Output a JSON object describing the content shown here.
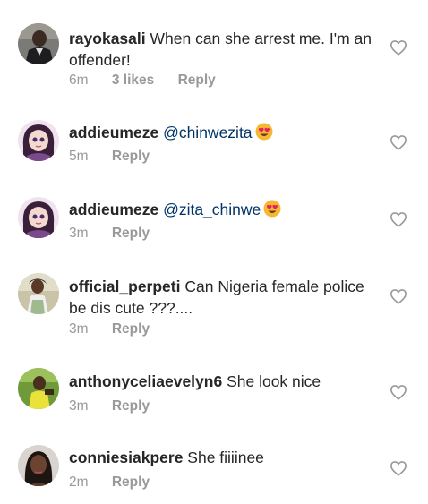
{
  "comments": [
    {
      "username": "rayokasali",
      "text": "When can she arrest me. I'm an offender!",
      "mention": "",
      "has_emoji": false,
      "time": "6m",
      "likes": "3 likes",
      "reply": "Reply",
      "avatar": "dark-suit-avatar"
    },
    {
      "username": "addieumeze",
      "text": "",
      "mention": "@chinwezita",
      "has_emoji": true,
      "time": "5m",
      "likes": "",
      "reply": "Reply",
      "avatar": "cartoon-girl-avatar"
    },
    {
      "username": "addieumeze",
      "text": "",
      "mention": "@zita_chinwe",
      "has_emoji": true,
      "time": "3m",
      "likes": "",
      "reply": "Reply",
      "avatar": "cartoon-girl-avatar"
    },
    {
      "username": "official_perpeti",
      "text": "Can Nigeria female police be dis cute ???....",
      "mention": "",
      "has_emoji": false,
      "time": "3m",
      "likes": "",
      "reply": "Reply",
      "avatar": "photo-woman-avatar"
    },
    {
      "username": "anthonyceliaevelyn6",
      "text": "She look nice",
      "mention": "",
      "has_emoji": false,
      "time": "3m",
      "likes": "",
      "reply": "Reply",
      "avatar": "green-photo-avatar"
    },
    {
      "username": "conniesiakpere",
      "text": "She fiiiinee",
      "mention": "",
      "has_emoji": false,
      "time": "2m",
      "likes": "",
      "reply": "Reply",
      "avatar": "portrait-woman-avatar"
    }
  ],
  "colors": {
    "text": "#262626",
    "mention": "#003569",
    "meta": "#999999",
    "heart_outline": "#999999",
    "emoji_face": "#f7b733",
    "emoji_heart": "#e0245e"
  }
}
